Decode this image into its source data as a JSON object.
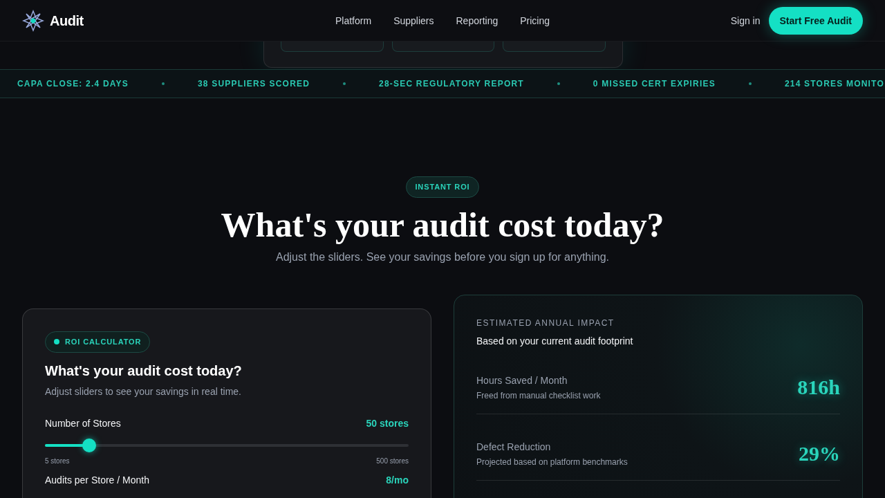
{
  "nav": {
    "brand": "Audit",
    "links": [
      "Platform",
      "Suppliers",
      "Reporting",
      "Pricing"
    ],
    "sign_in": "Sign in",
    "cta": "Start Free Audit"
  },
  "ticker": [
    "CAPA CLOSE: 2.4 DAYS",
    "38 SUPPLIERS SCORED",
    "28-SEC REGULATORY REPORT",
    "0 MISSED CERT EXPIRIES",
    "214 STORES MONITO"
  ],
  "hero": {
    "badge": "INSTANT ROI",
    "title": "What's your audit cost today?",
    "subtitle": "Adjust the sliders. See your savings before you sign up for anything."
  },
  "calculator": {
    "badge": "ROI CALCULATOR",
    "title": "What's your audit cost today?",
    "subtitle": "Adjust sliders to see your savings in real time.",
    "sliders": [
      {
        "label": "Number of Stores",
        "reading": "50 stores",
        "level": 0.106,
        "min_label": "5 stores",
        "max_label": "500 stores"
      },
      {
        "label": "Audits per Store / Month",
        "reading": "8/mo"
      }
    ]
  },
  "impact": {
    "eyebrow": "ESTIMATED ANNUAL IMPACT",
    "subtitle": "Based on your current audit footprint",
    "metrics": [
      {
        "label": "Hours Saved / Month",
        "note": "Freed from manual checklist work",
        "value": "816h"
      },
      {
        "label": "Defect Reduction",
        "note": "Projected based on platform benchmarks",
        "value": "29%"
      }
    ]
  }
}
